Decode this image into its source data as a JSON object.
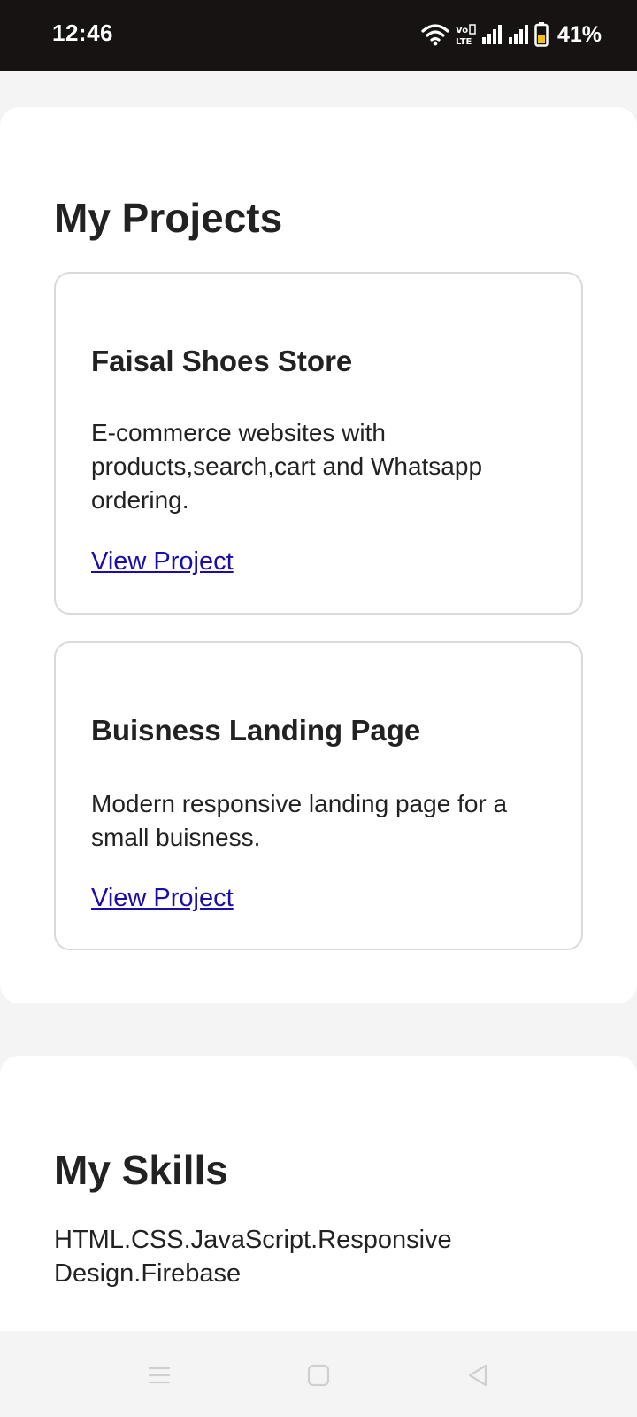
{
  "status_bar": {
    "time": "12:46",
    "battery": "41%",
    "icons": [
      "wifi-icon",
      "volte-icon",
      "signal-icon",
      "signal-icon",
      "battery-icon"
    ]
  },
  "projects": {
    "title": "My Projects",
    "items": [
      {
        "name": "Faisal Shoes Store",
        "description": "E-commerce websites with products,search,cart and Whatsapp ordering.",
        "link": "View Project"
      },
      {
        "name": "Buisness Landing Page",
        "description": "Modern responsive landing page for a small buisness.",
        "link": "View Project"
      }
    ]
  },
  "skills": {
    "title": "My Skills",
    "text": "HTML.CSS.JavaScript.Responsive Design.Firebase"
  },
  "nav_bar": {
    "icons": [
      "menu-icon",
      "home-icon",
      "back-icon"
    ]
  },
  "colors": {
    "status_bar": "#171313",
    "page_background": "#f4f4f4",
    "card_background": "#ffffff",
    "link": "#1a0dab"
  }
}
